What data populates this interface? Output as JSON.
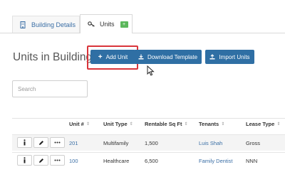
{
  "tabs": [
    {
      "label": "Building Details",
      "icon": "building-icon",
      "active": false
    },
    {
      "label": "Units",
      "icon": "key-icon",
      "active": true,
      "badge": "+"
    }
  ],
  "page_title": "Units in Building",
  "toolbar": {
    "add_unit": "Add Unit",
    "download_template": "Download Template",
    "import_units": "Import Units"
  },
  "search": {
    "placeholder": "Search",
    "value": ""
  },
  "table": {
    "columns": [
      "Unit #",
      "Unit Type",
      "Rentable Sq Ft",
      "Tenants",
      "Lease Type"
    ],
    "rows": [
      {
        "unit": "201",
        "type": "Multifamily",
        "sqft": "1,500",
        "tenant": "Luis Shah",
        "lease": "Gross"
      },
      {
        "unit": "100",
        "type": "Healthcare",
        "sqft": "6,500",
        "tenant": "Family Dentist",
        "lease": "NNN"
      }
    ]
  },
  "colors": {
    "primary_button": "#2f6fa4",
    "link": "#3a6ea5",
    "highlight": "#d9343a",
    "badge": "#5cb85c"
  }
}
